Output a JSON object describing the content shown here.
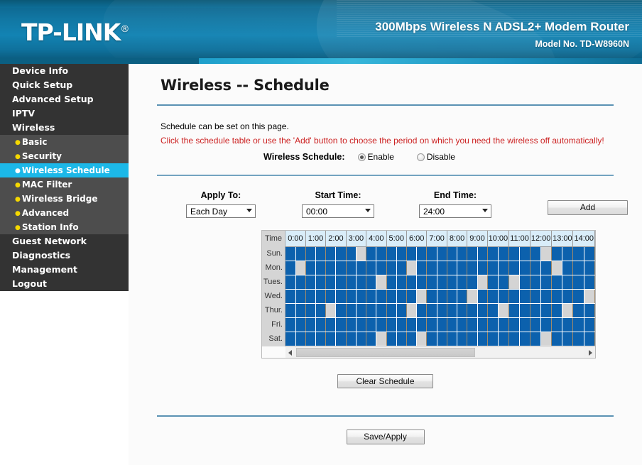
{
  "header": {
    "brand": "TP-LINK",
    "brand_reg": "®",
    "product": "300Mbps Wireless N ADSL2+ Modem Router",
    "model": "Model No. TD-W8960N"
  },
  "sidebar": {
    "items": [
      {
        "label": "Device Info",
        "level": "top",
        "active": false
      },
      {
        "label": "Quick Setup",
        "level": "top",
        "active": false
      },
      {
        "label": "Advanced Setup",
        "level": "top",
        "active": false
      },
      {
        "label": "IPTV",
        "level": "top",
        "active": false
      },
      {
        "label": "Wireless",
        "level": "top",
        "active": false
      },
      {
        "label": "Basic",
        "level": "sub",
        "active": false
      },
      {
        "label": "Security",
        "level": "sub",
        "active": false
      },
      {
        "label": "Wireless Schedule",
        "level": "sub",
        "active": true
      },
      {
        "label": "MAC Filter",
        "level": "sub",
        "active": false
      },
      {
        "label": "Wireless Bridge",
        "level": "sub",
        "active": false
      },
      {
        "label": "Advanced",
        "level": "sub",
        "active": false
      },
      {
        "label": "Station Info",
        "level": "sub",
        "active": false
      },
      {
        "label": "Guest Network",
        "level": "top",
        "active": false
      },
      {
        "label": "Diagnostics",
        "level": "top",
        "active": false
      },
      {
        "label": "Management",
        "level": "top",
        "active": false
      },
      {
        "label": "Logout",
        "level": "top",
        "active": false
      }
    ]
  },
  "main": {
    "title": "Wireless -- Schedule",
    "intro": "Schedule can be set on this page.",
    "warning": "Click the schedule table or use the 'Add' button to choose the period on which you need the wireless off automatically!",
    "schedule_toggle": {
      "label": "Wireless Schedule:",
      "options": [
        {
          "label": "Enable",
          "checked": true
        },
        {
          "label": "Disable",
          "checked": false
        }
      ]
    },
    "controls": {
      "apply_to": {
        "label": "Apply To:",
        "value": "Each Day"
      },
      "start_time": {
        "label": "Start Time:",
        "value": "00:00"
      },
      "end_time": {
        "label": "End Time:",
        "value": "24:00"
      },
      "add_button": "Add"
    },
    "buttons": {
      "clear_schedule": "Clear Schedule",
      "save_apply": "Save/Apply"
    }
  },
  "schedule_table": {
    "time_header": "Time",
    "hours": [
      "0:00",
      "1:00",
      "2:00",
      "3:00",
      "4:00",
      "5:00",
      "6:00",
      "7:00",
      "8:00",
      "9:00",
      "10:00",
      "11:00",
      "12:00",
      "13:00",
      "14:00"
    ],
    "days": [
      "Sun.",
      "Mon.",
      "Tues.",
      "Wed.",
      "Thur.",
      "Fri.",
      "Sat."
    ],
    "slots_per_hour": 2,
    "legend": {
      "on_color": "#0c61ad",
      "off_color": "#d4d4d4"
    },
    "rows": [
      {
        "day": "Sun.",
        "off_slots": [
          7,
          25
        ]
      },
      {
        "day": "Mon.",
        "off_slots": [
          1,
          12,
          26
        ]
      },
      {
        "day": "Tues.",
        "off_slots": [
          9,
          19,
          22
        ]
      },
      {
        "day": "Wed.",
        "off_slots": [
          13,
          18,
          29
        ]
      },
      {
        "day": "Thur.",
        "off_slots": [
          4,
          12,
          21,
          27
        ]
      },
      {
        "day": "Fri.",
        "off_slots": []
      },
      {
        "day": "Sat.",
        "off_slots": [
          9,
          13,
          25
        ]
      }
    ]
  },
  "scrollbar": {
    "left_arrow": "left-arrow",
    "right_arrow": "right-arrow",
    "thumb_percent": 62
  }
}
